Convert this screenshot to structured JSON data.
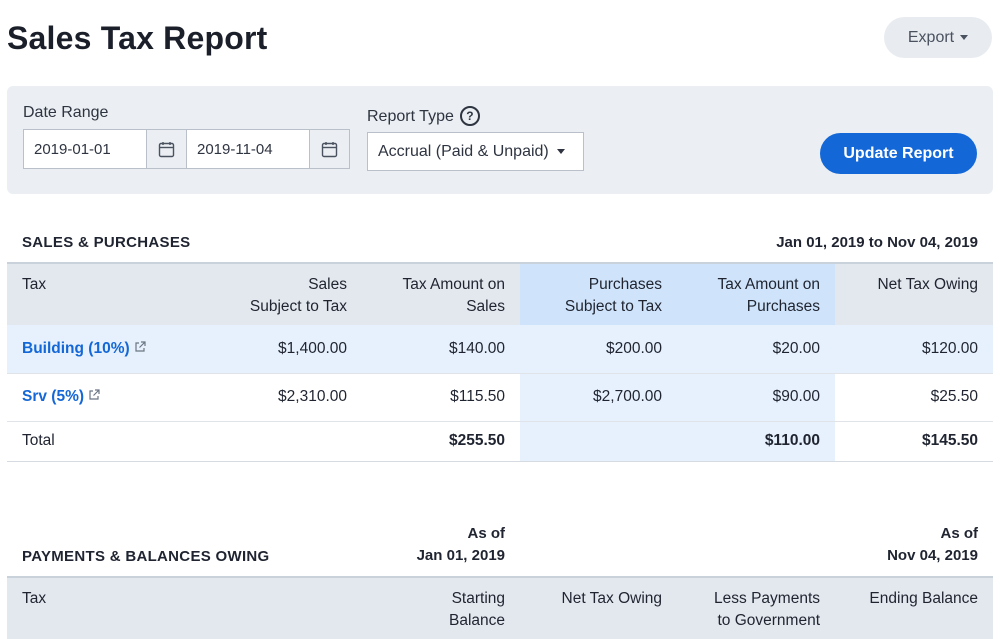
{
  "header": {
    "title": "Sales Tax Report",
    "export_label": "Export"
  },
  "filters": {
    "date_range_label": "Date Range",
    "start_date": "2019-01-01",
    "end_date": "2019-11-04",
    "report_type_label": "Report Type",
    "report_type_value": "Accrual (Paid & Unpaid)",
    "update_label": "Update Report"
  },
  "sales_purchases": {
    "heading": "SALES & PURCHASES",
    "range": "Jan 01, 2019 to Nov 04, 2019",
    "columns": {
      "tax": "Tax",
      "sales_line1": "Sales",
      "sales_line2": "Subject to Tax",
      "tax_sales_line1": "Tax Amount on",
      "tax_sales_line2": "Sales",
      "purchases_line1": "Purchases",
      "purchases_line2": "Subject to Tax",
      "tax_purchases_line1": "Tax Amount on",
      "tax_purchases_line2": "Purchases",
      "net": "Net Tax Owing"
    },
    "rows": [
      {
        "tax": "Building (10%)",
        "sales": "$1,400.00",
        "tax_sales": "$140.00",
        "purchases": "$200.00",
        "tax_purchases": "$20.00",
        "net": "$120.00"
      },
      {
        "tax": "Srv (5%)",
        "sales": "$2,310.00",
        "tax_sales": "$115.50",
        "purchases": "$2,700.00",
        "tax_purchases": "$90.00",
        "net": "$25.50"
      }
    ],
    "total": {
      "label": "Total",
      "tax_sales": "$255.50",
      "tax_purchases": "$110.00",
      "net": "$145.50"
    }
  },
  "payments_balances": {
    "heading": "PAYMENTS & BALANCES OWING",
    "asof_start_line1": "As of",
    "asof_start_line2": "Jan 01, 2019",
    "asof_end_line1": "As of",
    "asof_end_line2": "Nov 04, 2019",
    "columns": {
      "tax": "Tax",
      "starting_line1": "Starting",
      "starting_line2": "Balance",
      "net": "Net Tax Owing",
      "less_payments_line1": "Less Payments",
      "less_payments_line2": "to Government",
      "ending": "Ending Balance"
    }
  },
  "colors": {
    "accent": "#1467d6",
    "header_bg": "#e3e8ee",
    "purchase_highlight": "#cfe4fb"
  }
}
